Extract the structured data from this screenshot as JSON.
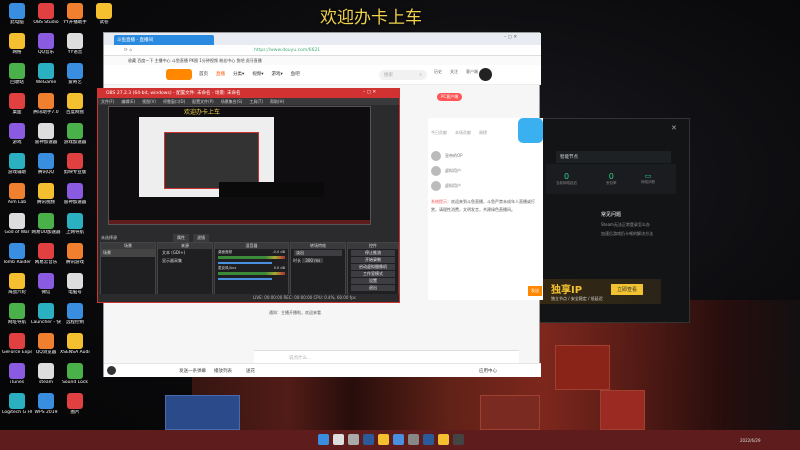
{
  "banner": "欢迎办卡上车",
  "desktop_icons": [
    [
      "此电脑",
      "网络",
      "回收站",
      "桌面",
      "游戏",
      "游戏辅助",
      "Aim Lab",
      "God of War",
      "Tomb Raider",
      "海战六轮",
      "网址导航",
      "GeForce Experience",
      "iTunes",
      "Logitech G HUB"
    ],
    [
      "OBS Studio",
      "QQ音乐",
      "WeGame",
      "腾讯助手7.0",
      "雷神加速器",
      "腾讯QQ",
      "腾讯视频",
      "网易UU加速器",
      "网易云音乐",
      "微信",
      "Launcher - 快捷方式",
      "QQ浏览器",
      "steam",
      "WPS 2019"
    ],
    [
      "YY开播助手",
      "YY语音",
      "爱奇艺",
      "百度网盘",
      "游戏加速器",
      "剪映专业版",
      "雷神加速器",
      "上网导航",
      "腾讯游戏",
      "电脑号",
      "远程控制",
      "XSENSA Audio",
      "Sound Lock",
      "图片"
    ],
    [
      "试卷"
    ]
  ],
  "browser": {
    "tab": "斗鱼直播 - 直播间",
    "url": "https://www.douyu.com/6621",
    "bookmarks": "收藏   百度一下   主播中心   斗鱼直播   PK图   1分钟视频   粉丝中心   鱼吧   虎牙直播",
    "nav": [
      "首页",
      "直播",
      "分类▾",
      "视频▾",
      "游戏▾",
      "鱼吧"
    ],
    "search_placeholder": "搜索",
    "nav_icons": [
      "历史",
      "关注",
      "客户端"
    ],
    "pc_client": "PC客户端",
    "chat_tabs": [
      "今日贡献",
      "本场贡献",
      "周榜"
    ],
    "users": [
      "皇帝的OP",
      "虚拟用户",
      "虚拟用户"
    ],
    "notice_title": "系统提示：",
    "notice": "欢迎来到斗鱼直播，斗鱼严禁未成年人直播或打赏，请理性消费，文明发言，共建绿色直播间。",
    "chat_placeholder": "说点什么...",
    "send": "发送",
    "bottom": [
      "发送一条弹幕",
      "播放列表",
      "送花"
    ],
    "app_center": "应用中心",
    "system_msg": "通知：主播开播啦，欢迎来看"
  },
  "obs": {
    "title": "OBS 27.2.3 (64-bit, windows) - 配置文件: 未命名 - 场景: 未命名",
    "menu": [
      "文件(F)",
      "编辑(E)",
      "视图(V)",
      "停靠窗口(D)",
      "配置文件(P)",
      "场景集合(S)",
      "工具(T)",
      "帮助(H)"
    ],
    "no_source": "未选择源",
    "props": "属性",
    "filters": "滤镜",
    "docks": [
      "场景",
      "来源",
      "混音器",
      "转场特效",
      "控件"
    ],
    "scene": "场景",
    "sources": [
      "文本 (GDI+)",
      "显示器采集"
    ],
    "mixer": [
      {
        "name": "桌面音频",
        "db": "-0.0 dB"
      },
      {
        "name": "麦克风/Aux",
        "db": "0.0 dB"
      }
    ],
    "transition": "淡出",
    "duration_label": "时长",
    "duration": "300 ms",
    "controls": [
      "停止推流",
      "开始录制",
      "启动虚拟摄像机",
      "工作室模式",
      "设置",
      "退出"
    ],
    "status": "LIVE: 00:00:00   REC: 00:00:00   CPU: 0.4%, 60.00 fps"
  },
  "dark_app": {
    "search": "搜索",
    "node": "智能节点",
    "stats": [
      {
        "value": "0",
        "unit": "ms",
        "label": "当前网络延迟"
      },
      {
        "value": "0",
        "unit": "%",
        "label": "丢包率"
      },
      {
        "value": "",
        "unit": "",
        "label": "网络诊断"
      }
    ],
    "faq_title": "常见问题",
    "faq": [
      "Steam无法正常登录怎么办",
      "加速后游戏仍卡顿的解决方法"
    ],
    "ad": "独享IP",
    "ad_sub": "独立节点 / 安全稳定 / 低延迟",
    "ad_button": "立即查看"
  },
  "taskbar": {
    "clock": "2022/6/29"
  }
}
